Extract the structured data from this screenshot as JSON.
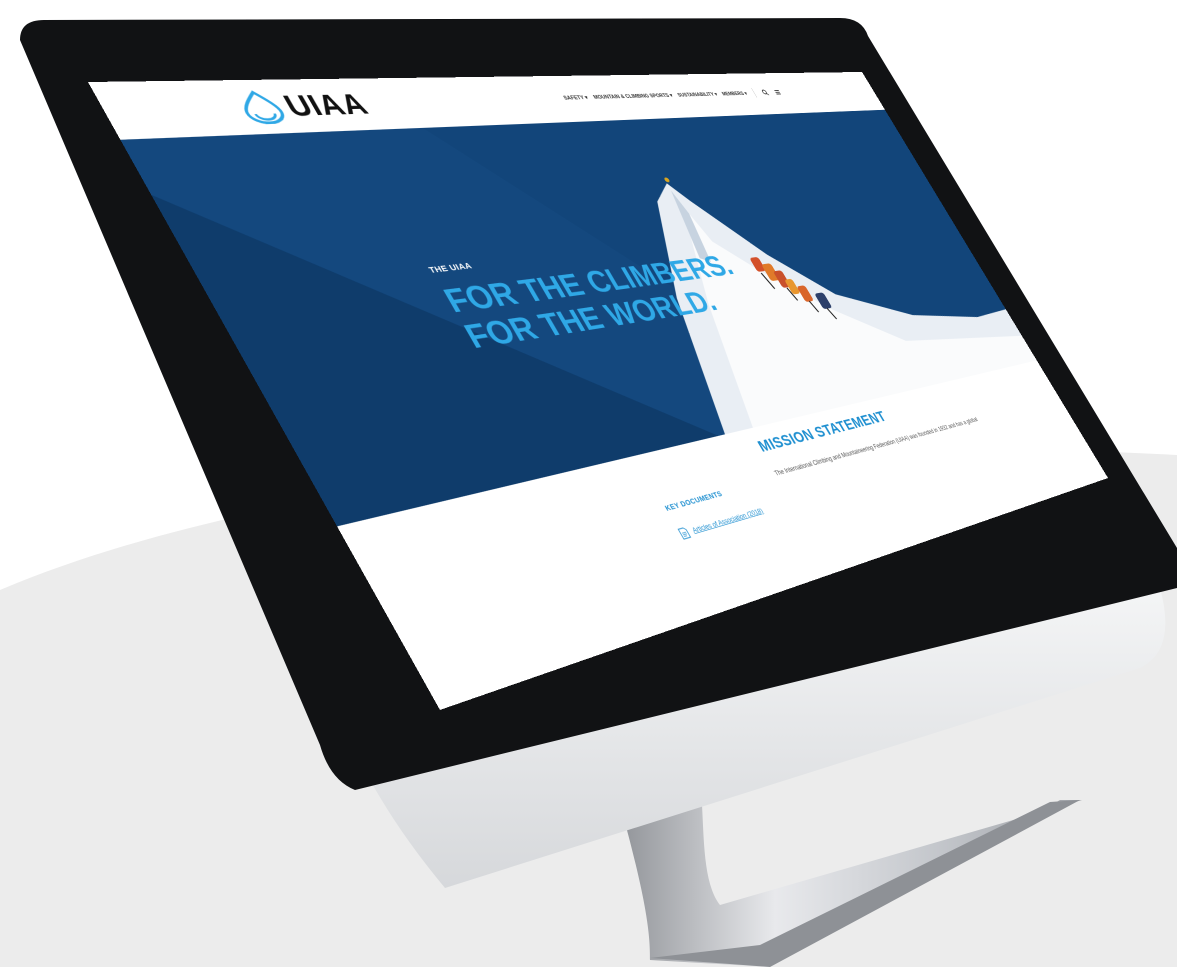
{
  "header": {
    "logo_text": "UIAA",
    "nav": [
      "SAFETY ▾",
      "MOUNTAIN & CLIMBING SPORTS ▾",
      "SUSTAINABILITY ▾",
      "MEMBERS ▾"
    ],
    "icons": [
      "search-icon",
      "menu-icon"
    ]
  },
  "hero": {
    "eyebrow": "THE UIAA",
    "title_line1": "FOR THE CLIMBERS.",
    "title_line2": "FOR THE WORLD."
  },
  "mission": {
    "title": "MISSION STATEMENT",
    "text": "The International Climbing and Mountaineering Federation (UIAA) was founded in 1932 and has a global"
  },
  "key_documents": {
    "title": "KEY DOCUMENTS",
    "link": "Articles of Association (2018)"
  },
  "colors": {
    "brand_blue": "#12457a",
    "accent_blue": "#2fa8e6",
    "link_blue": "#1e8fd0"
  }
}
